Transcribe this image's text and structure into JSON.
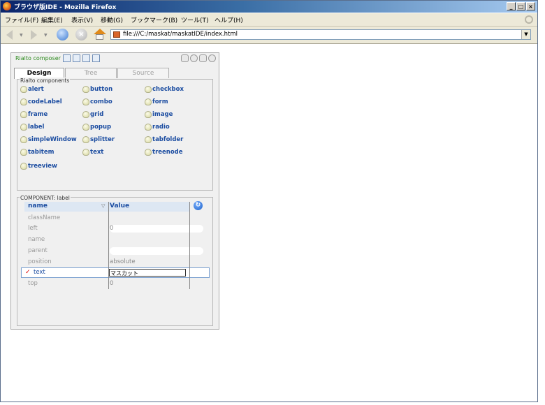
{
  "window": {
    "title": "ブラウザ版IDE - Mozilla Firefox",
    "buttons": [
      "_",
      "□",
      "×"
    ]
  },
  "menubar": {
    "items": [
      "ファイル(F)",
      "編集(E)",
      "表示(V)",
      "移動(G)",
      "ブックマーク(B)",
      "ツール(T)",
      "ヘルプ(H)"
    ]
  },
  "navbar": {
    "url": "file:///C:/maskat/maskatIDE/index.html",
    "stop_glyph": "×",
    "dropdown_glyph": "▼",
    "drop_glyph": "▼"
  },
  "panel": {
    "title": "Rialto composer",
    "tabs": [
      "Design",
      "Tree",
      "Source"
    ],
    "components_legend": "Rialto components",
    "components": [
      "alert",
      "button",
      "checkbox",
      "codeLabel",
      "combo",
      "form",
      "frame",
      "grid",
      "image",
      "label",
      "popup",
      "radio",
      "simpleWindow",
      "splitter",
      "tabfolder",
      "tabitem",
      "text",
      "treenode",
      "treeview"
    ],
    "props_legend": "COMPONENT: label",
    "props_header": {
      "name": "name",
      "value": "Value",
      "sort_glyph": "▽"
    },
    "properties": [
      {
        "name": "className",
        "value": ""
      },
      {
        "name": "left",
        "value": "0"
      },
      {
        "name": "name",
        "value": ""
      },
      {
        "name": "parent",
        "value": ""
      },
      {
        "name": "position",
        "value": "absolute"
      },
      {
        "name": "text",
        "value": "マスカット"
      },
      {
        "name": "top",
        "value": "0"
      }
    ],
    "check_glyph": "✓",
    "refresh_glyph": "↻"
  }
}
